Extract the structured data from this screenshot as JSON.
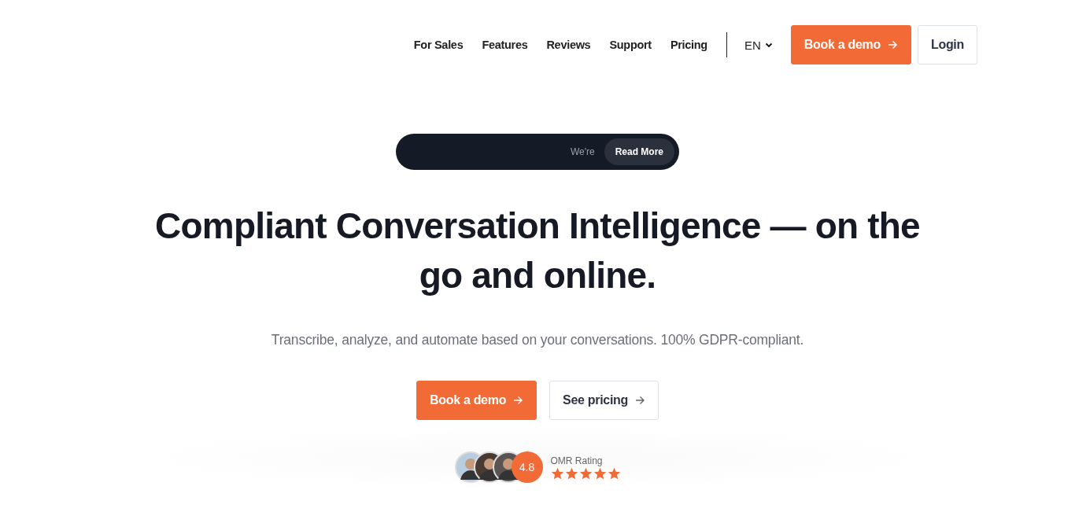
{
  "nav": {
    "links": [
      {
        "label": "For Sales"
      },
      {
        "label": "Features"
      },
      {
        "label": "Reviews"
      },
      {
        "label": "Support"
      },
      {
        "label": "Pricing"
      }
    ],
    "language": "EN",
    "demo_button": "Book a demo",
    "login_button": "Login"
  },
  "banner": {
    "text": "We're",
    "button": "Read More"
  },
  "hero": {
    "title": "Compliant Conversation Intelligence — on the go and online.",
    "subtitle": "Transcribe, analyze, and automate based on your conversations. 100% GDPR-compliant.",
    "buttons": [
      {
        "label": "Book a demo",
        "kind": "primary"
      },
      {
        "label": "See pricing",
        "kind": "secondary"
      }
    ]
  },
  "rating": {
    "score": "4.8",
    "label": "OMR Rating",
    "stars": 5,
    "avatars": [
      {
        "kind": "picture"
      },
      {
        "kind": "picture"
      },
      {
        "kind": "picture"
      }
    ]
  }
}
